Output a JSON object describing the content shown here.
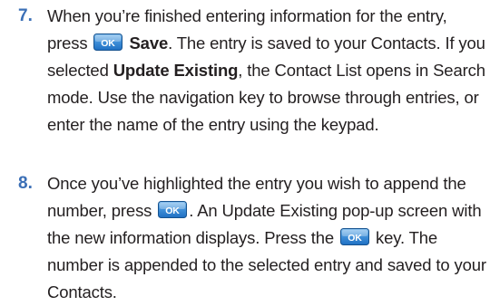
{
  "steps": [
    {
      "number": "7.",
      "parts": {
        "t1": "When you’re finished entering information for the entry, press ",
        "b1": "Save",
        "t2": ". The entry is saved to your Contacts. If you selected ",
        "b2": "Update Existing",
        "t3": ", the Contact List opens in Search mode. Use the navigation key to browse through entries, or enter the name of the entry using the keypad."
      }
    },
    {
      "number": "8.",
      "parts": {
        "t1": "Once you’ve highlighted the entry you wish to append the number, press ",
        "t2": ". An Update Existing pop-up screen with the new information displays. Press the ",
        "t3": " key. The number is appended to the selected entry and saved to your Contacts."
      }
    }
  ],
  "ok_key": {
    "icon": "ok-key-icon",
    "label": "OK",
    "color_top": "#7fb7e8",
    "color_bottom": "#1f6fc2",
    "border": "#15528f"
  }
}
